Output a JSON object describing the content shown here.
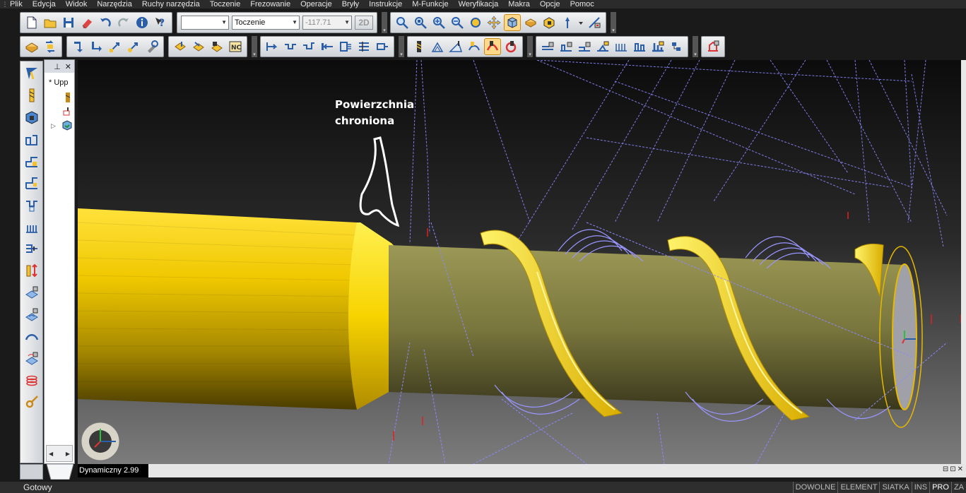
{
  "menu": [
    "Plik",
    "Edycja",
    "Widok",
    "Narzędzia",
    "Ruchy narzędzia",
    "Toczenie",
    "Frezowanie",
    "Operacje",
    "Bryły",
    "Instrukcje",
    "M-Funkcje",
    "Weryfikacja",
    "Makra",
    "Opcje",
    "Pomoc"
  ],
  "toolbar": {
    "combo_empty": "",
    "mode_combo": "Toczenie",
    "coord_combo": "-117.71",
    "btn_2d": "2D"
  },
  "tree": {
    "tab_label": "* Upp",
    "pin": "⊥",
    "close": "✕"
  },
  "viewport": {
    "annotation_line1": "Powierzchnia",
    "annotation_line2": "chroniona"
  },
  "bottom": {
    "dyn_label": "Dynamiczny 2.99",
    "status": "Gotowy",
    "cells": [
      "DOWOLNE",
      "ELEMENT",
      "SIATKA",
      "INS",
      "PRO",
      "ZA"
    ]
  },
  "colors": {
    "workpiece": "#f2d000",
    "part": "#7d7a3e",
    "toolpath": "#8c88ff",
    "dark_bg": "#1a1a1a"
  }
}
